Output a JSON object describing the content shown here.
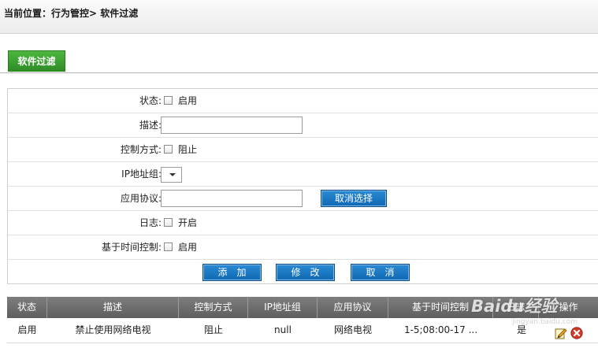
{
  "header": {
    "breadcrumb": "当前位置：行为管控> 软件过滤"
  },
  "tabs": [
    {
      "label": "软件过滤",
      "active": true
    }
  ],
  "form": {
    "status": {
      "label": "状态:",
      "checkbox_label": "启用",
      "checked": false
    },
    "description": {
      "label": "描述:",
      "value": ""
    },
    "control_mode": {
      "label": "控制方式:",
      "checkbox_label": "阻止",
      "checked": false
    },
    "ip_group": {
      "label": "IP地址组:",
      "value": ""
    },
    "protocol": {
      "label": "应用协议:",
      "value": "",
      "cancel_select_label": "取消选择"
    },
    "log": {
      "label": "日志:",
      "checkbox_label": "开启",
      "checked": false
    },
    "time_control": {
      "label": "基于时间控制:",
      "checkbox_label": "启用",
      "checked": false
    },
    "buttons": {
      "add": "添　加",
      "modify": "修　改",
      "cancel": "取　消"
    }
  },
  "table": {
    "columns": [
      "状态",
      "描述",
      "控制方式",
      "IP地址组",
      "应用协议",
      "基于时间控制",
      "日志",
      "操作"
    ],
    "rows": [
      {
        "status": "启用",
        "description": "禁止使用网络电视",
        "control_mode": "阻止",
        "ip_group": "null",
        "protocol": "网络电视",
        "time_control": "1-5;08:00-17 ...",
        "log": "是"
      }
    ]
  },
  "watermark": {
    "text": "Baidu经验",
    "sub": "jingyan.baidu.com"
  },
  "colors": {
    "tab_green": "#3ba231",
    "button_blue": "#1a79c4",
    "table_header": "#6e6e6e",
    "delete_red": "#d23a2a"
  }
}
